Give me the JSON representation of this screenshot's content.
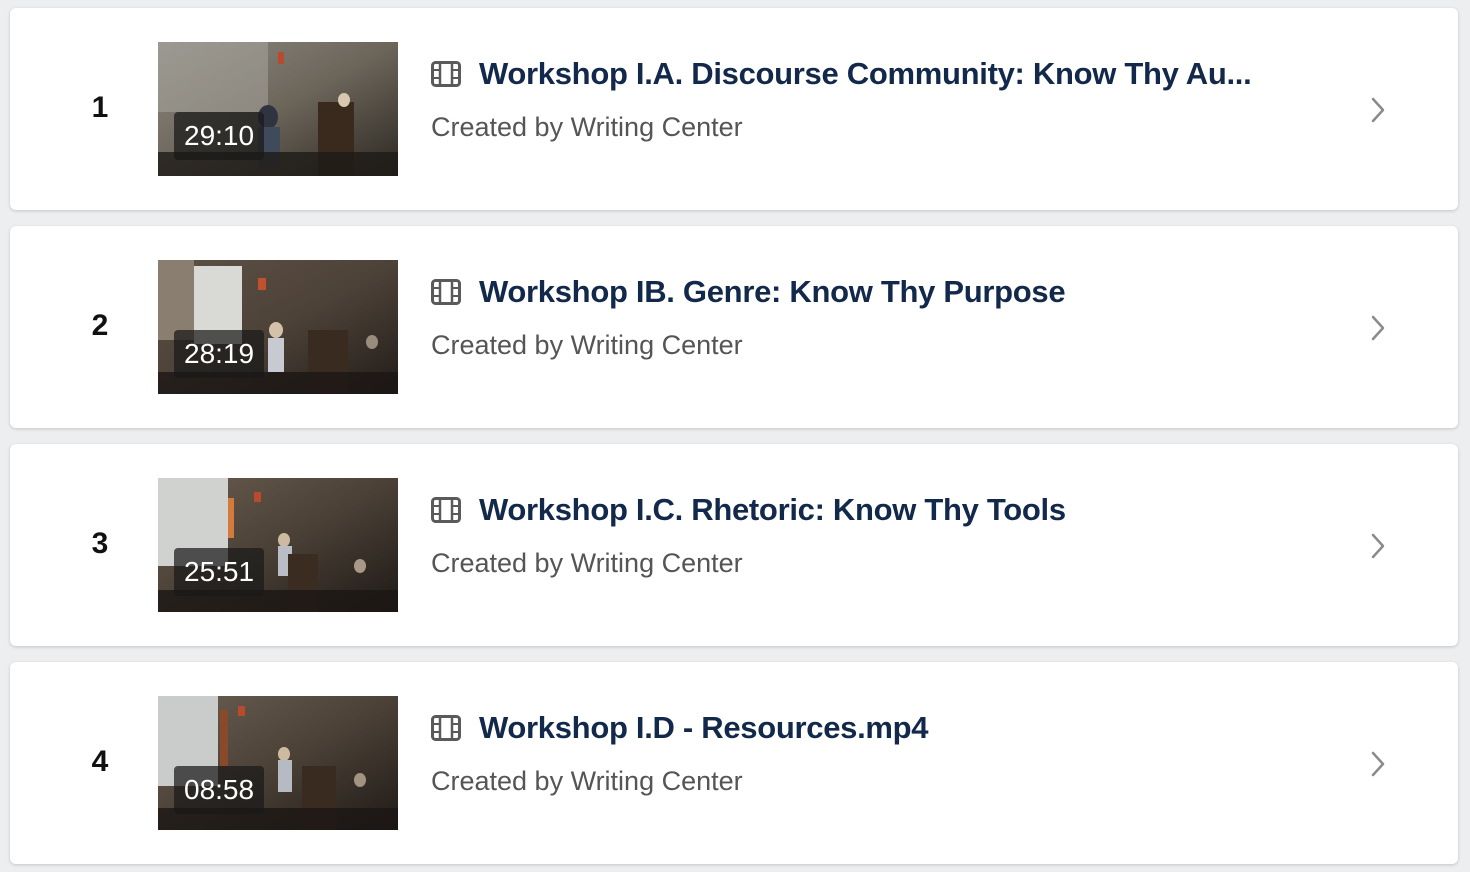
{
  "items": [
    {
      "index": "1",
      "duration": "29:10",
      "title": "Workshop I.A. Discourse Community: Know Thy Au...",
      "creator": "Created by Writing Center",
      "icon": "film-icon"
    },
    {
      "index": "2",
      "duration": "28:19",
      "title": "Workshop IB. Genre: Know Thy Purpose",
      "creator": "Created by Writing Center",
      "icon": "film-icon"
    },
    {
      "index": "3",
      "duration": "25:51",
      "title": "Workshop I.C. Rhetoric: Know Thy Tools",
      "creator": "Created by Writing Center",
      "icon": "film-icon"
    },
    {
      "index": "4",
      "duration": "08:58",
      "title": "Workshop I.D - Resources.mp4",
      "creator": "Created by Writing Center",
      "icon": "film-icon"
    }
  ],
  "colors": {
    "title": "#13294b",
    "creator": "#555555",
    "chevron": "#8a8a8a",
    "background": "#eceef0",
    "card": "#ffffff"
  }
}
